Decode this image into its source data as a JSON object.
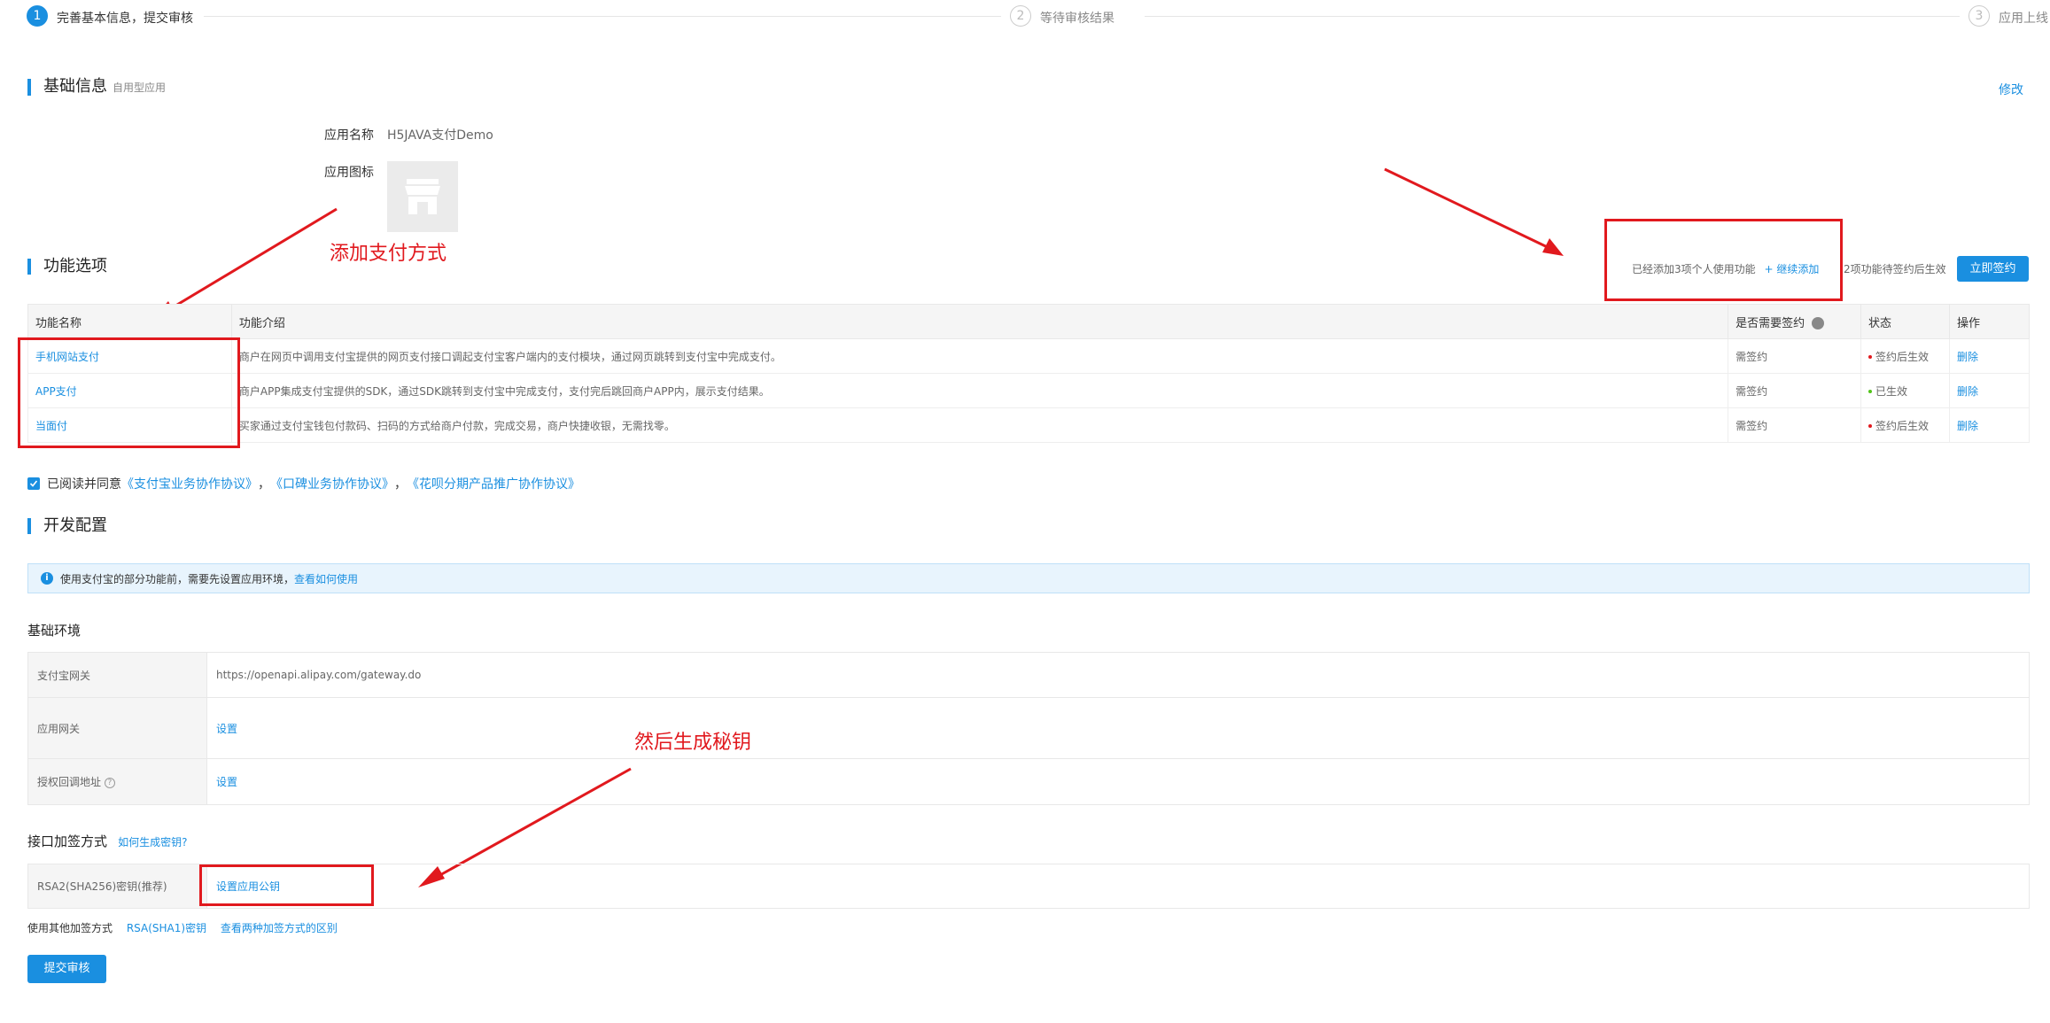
{
  "steps": [
    {
      "num": "1",
      "label": "完善基本信息，提交审核"
    },
    {
      "num": "2",
      "label": "等待审核结果"
    },
    {
      "num": "3",
      "label": "应用上线"
    }
  ],
  "basic": {
    "title": "基础信息",
    "subtitle": "自用型应用",
    "edit": "修改",
    "name_label": "应用名称",
    "name_value": "H5JAVA支付Demo",
    "icon_label": "应用图标"
  },
  "annotations": {
    "add_payment": "添加支付方式",
    "gen_key": "然后生成秘钥"
  },
  "func": {
    "title": "功能选项",
    "added_text": "已经添加3项个人使用功能",
    "continue_add": "+ 继续添加",
    "pending_text": "2项功能待签约后生效",
    "sign_now": "立即签约",
    "headers": [
      "功能名称",
      "功能介绍",
      "是否需要签约",
      "状态",
      "操作"
    ],
    "rows": [
      {
        "name": "手机网站支付",
        "desc": "商户在网页中调用支付宝提供的网页支付接口调起支付宝客户端内的支付模块，通过网页跳转到支付宝中完成支付。",
        "sign": "需签约",
        "status": "签约后生效",
        "status_color": "#e1191e",
        "op": "删除"
      },
      {
        "name": "APP支付",
        "desc": "商户APP集成支付宝提供的SDK，通过SDK跳转到支付宝中完成支付，支付完后跳回商户APP内，展示支付结果。",
        "sign": "需签约",
        "status": "已生效",
        "status_color": "#52c41a",
        "op": "删除"
      },
      {
        "name": "当面付",
        "desc": "买家通过支付宝钱包付款码、扫码的方式给商户付款，完成交易，商户快捷收银，无需找零。",
        "sign": "需签约",
        "status": "签约后生效",
        "status_color": "#e1191e",
        "op": "删除"
      }
    ]
  },
  "agree": {
    "prefix": "已阅读并同意",
    "link1": "《支付宝业务协作协议》",
    "link2": "《口碑业务协作协议》",
    "link3": "《花呗分期产品推广协作协议》",
    "sep": "，"
  },
  "dev": {
    "title": "开发配置",
    "info_text": "使用支付宝的部分功能前，需要先设置应用环境，",
    "info_link": "查看如何使用",
    "env_title": "基础环境",
    "env_rows": [
      {
        "key": "支付宝网关",
        "value": "https://openapi.alipay.com/gateway.do",
        "is_link": false
      },
      {
        "key": "应用网关",
        "value": "设置",
        "is_link": true
      },
      {
        "key": "授权回调地址",
        "value": "设置",
        "is_link": true
      }
    ],
    "sign_title": "接口加签方式",
    "sign_help": "如何生成密钥?",
    "sign_row_key": "RSA2(SHA256)密钥(推荐)",
    "sign_row_value": "设置应用公钥",
    "other_label": "使用其他加签方式",
    "other_link1": "RSA(SHA1)密钥",
    "other_link2": "查看两种加签方式的区别",
    "submit": "提交审核"
  }
}
